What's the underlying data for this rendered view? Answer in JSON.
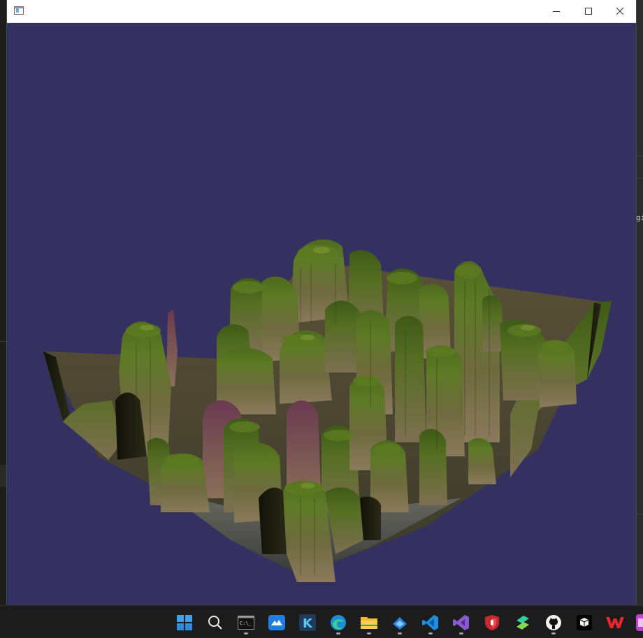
{
  "window": {
    "title": "",
    "background_color": "#343160",
    "controls": {
      "minimize": "minimize-icon",
      "maximize": "maximize-icon",
      "close": "close-icon"
    }
  },
  "scene": {
    "description_icon": "terrain-render",
    "terrain_colors": [
      "#3d5a1c",
      "#6b7a2a",
      "#8a7a5a",
      "#4a3a4a",
      "#1a1a10"
    ]
  },
  "background_window": {
    "peek_text": "gi"
  },
  "taskbar": {
    "items": [
      {
        "name": "start-icon",
        "running": false
      },
      {
        "name": "search-icon",
        "running": false
      },
      {
        "name": "terminal-icon",
        "running": true
      },
      {
        "name": "mail-icon",
        "running": false
      },
      {
        "name": "k-app-icon",
        "running": false
      },
      {
        "name": "edge-icon",
        "running": true
      },
      {
        "name": "file-explorer-icon",
        "running": true
      },
      {
        "name": "store-icon",
        "running": true
      },
      {
        "name": "vscode-icon",
        "running": true
      },
      {
        "name": "visual-studio-icon",
        "running": true
      },
      {
        "name": "security-shield-icon",
        "running": false
      },
      {
        "name": "bolt-app-icon",
        "running": false
      },
      {
        "name": "github-icon",
        "running": true
      },
      {
        "name": "cube-app-icon",
        "running": false
      },
      {
        "name": "wps-icon",
        "running": false
      },
      {
        "name": "partial-app-icon",
        "running": false
      }
    ]
  }
}
